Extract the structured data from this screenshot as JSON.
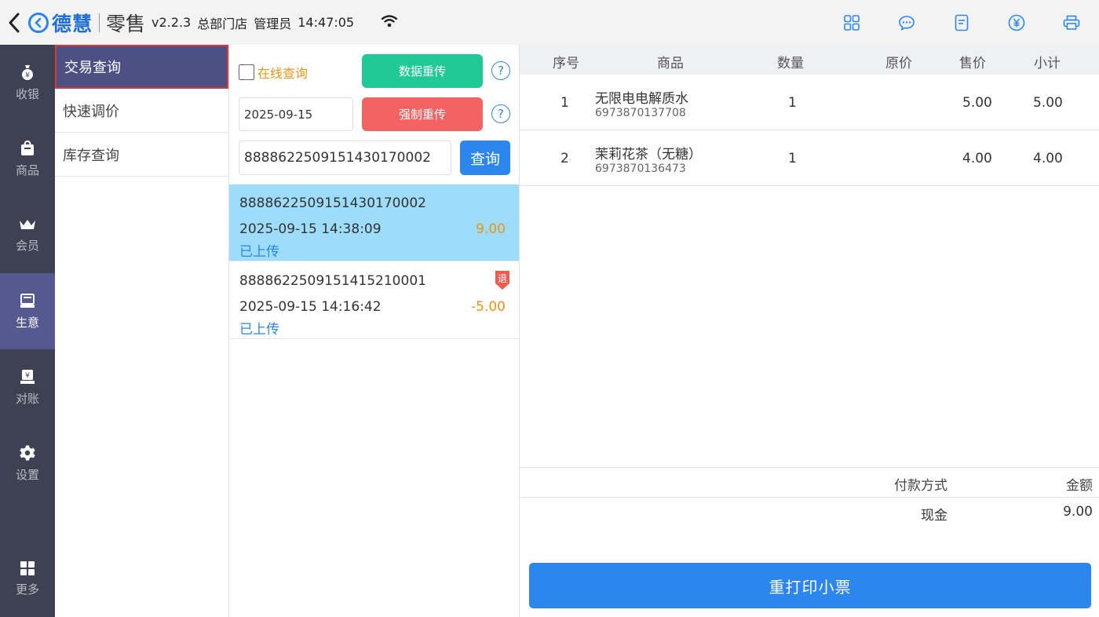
{
  "header": {
    "brand": "德慧",
    "product": "零售",
    "version": "v2.2.3",
    "store": "总部门店",
    "user": "管理员",
    "time": "14:47:05"
  },
  "leftnav": [
    {
      "label": "收银",
      "icon": "cash-bag-icon"
    },
    {
      "label": "商品",
      "icon": "shopping-bag-icon"
    },
    {
      "label": "会员",
      "icon": "crown-icon"
    },
    {
      "label": "生意",
      "icon": "register-icon"
    },
    {
      "label": "对账",
      "icon": "reconcile-icon"
    },
    {
      "label": "设置",
      "icon": "gear-icon"
    },
    {
      "label": "更多",
      "icon": "grid-icon"
    }
  ],
  "submenu": [
    {
      "label": "交易查询"
    },
    {
      "label": "快速调价"
    },
    {
      "label": "库存查询"
    }
  ],
  "controls": {
    "online_query": "在线查询",
    "data_reupload": "数据重传",
    "force_reupload": "强制重传",
    "date": "2025-09-15",
    "search_value": "8888622509151430170002",
    "query_btn": "查询",
    "help": "?"
  },
  "orders": [
    {
      "no": "8888622509151430170002",
      "time": "2025-09-15 14:38:09",
      "amount": "9.00",
      "status": "已上传",
      "refund": ""
    },
    {
      "no": "8888622509151415210001",
      "time": "2025-09-15 14:16:42",
      "amount": "-5.00",
      "status": "已上传",
      "refund": "退"
    }
  ],
  "table": {
    "headers": {
      "index": "序号",
      "product": "商品",
      "qty": "数量",
      "orig_price": "原价",
      "price": "售价",
      "subtotal": "小计"
    },
    "rows": [
      {
        "index": "1",
        "name": "无限电电解质水",
        "code": "6973870137708",
        "qty": "1",
        "orig_price": "",
        "price": "5.00",
        "subtotal": "5.00"
      },
      {
        "index": "2",
        "name": "茉莉花茶（无糖）",
        "code": "6973870136473",
        "qty": "1",
        "orig_price": "",
        "price": "4.00",
        "subtotal": "4.00"
      }
    ]
  },
  "payment": {
    "method_header": "付款方式",
    "amount_header": "金额",
    "method": "现金",
    "amount": "9.00"
  },
  "reprint_label": "重打印小票",
  "colors": {
    "accent": "#2d86ee",
    "green": "#20c997",
    "red": "#f36363",
    "orange": "#e8951c",
    "nav_bg": "#3d4152",
    "nav_active": "#54598f"
  }
}
